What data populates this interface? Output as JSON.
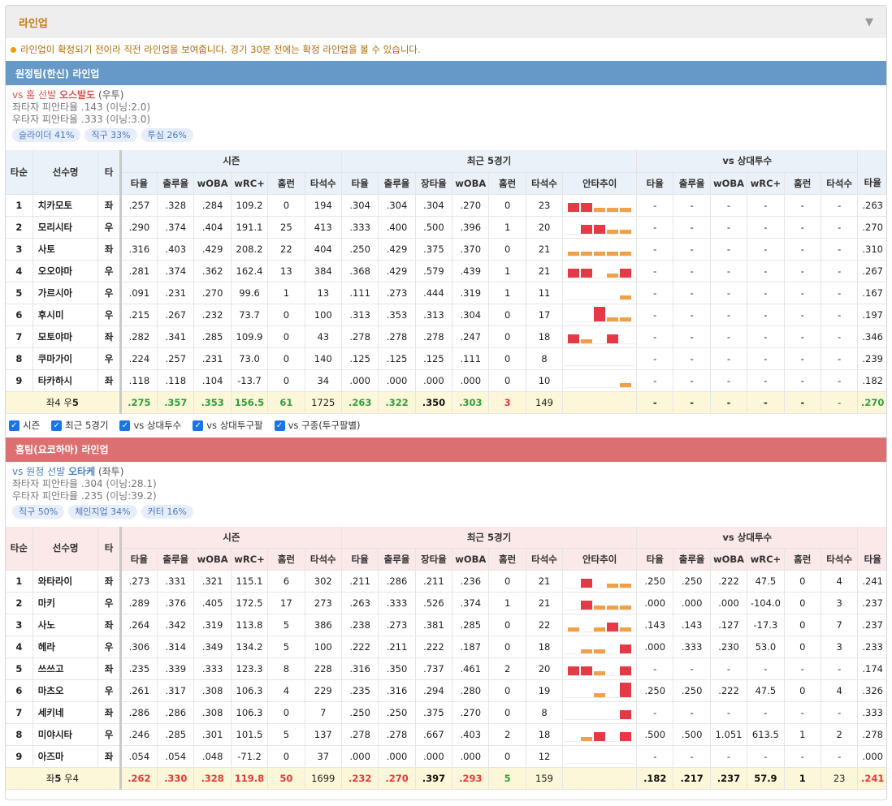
{
  "title": "라인업",
  "notice": "라인업이 확정되기 전이라 직전 라인업을 보여줍니다. 경기 30분 전에는 확정 라인업을 볼 수 있습니다.",
  "checkboxes": [
    "시즌",
    "최근 5경기",
    "vs 상대투수",
    "vs 상대투구팔",
    "vs 구종(투구팔별)"
  ],
  "headers": {
    "order": "타순",
    "name": "선수명",
    "hand": "타",
    "season": "시즌",
    "recent": "최근 5경기",
    "vs": "vs 상대투수",
    "trend": "안타추이",
    "cols_season": [
      "타율",
      "출루율",
      "wOBA",
      "wRC+",
      "홈런",
      "타석수"
    ],
    "cols_recent": [
      "타율",
      "출루율",
      "장타율",
      "wOBA",
      "홈런",
      "타석수"
    ],
    "cols_vs": [
      "타율",
      "출루율",
      "wOBA",
      "wRC+",
      "홈런",
      "타석수"
    ],
    "col_last": "타율"
  },
  "colors": {
    "hit_high": "#e53945",
    "hit_low": "#f0a048"
  },
  "away": {
    "team": "원정팀(한신) 라인업",
    "vs_label": "vs 홈 선발",
    "pitcher": "오스발도",
    "hand": "(우투)",
    "stat1": "좌타자 피안타율 .143 (이닝:2.0)",
    "stat2": "우타자 피안타율 .333 (이닝:3.0)",
    "tags": [
      "슬라이더 41%",
      "직구 33%",
      "투심 26%"
    ],
    "rows": [
      {
        "no": "1",
        "name": "치카모토",
        "hand": "좌",
        "season": [
          ".257",
          ".328",
          ".284",
          "109.2",
          "0",
          "194"
        ],
        "recent": [
          ".304",
          ".304",
          ".304",
          ".270",
          "0",
          "23"
        ],
        "trend": [
          2,
          2,
          1,
          1,
          1
        ],
        "vs": [
          "-",
          "-",
          "-",
          "-",
          "-",
          "-"
        ],
        "last": ".263"
      },
      {
        "no": "2",
        "name": "모리시타",
        "hand": "우",
        "season": [
          ".290",
          ".374",
          ".404",
          "191.1",
          "25",
          "413"
        ],
        "recent": [
          ".333",
          ".400",
          ".500",
          ".396",
          "1",
          "20"
        ],
        "trend": [
          0,
          2,
          2,
          1,
          1
        ],
        "vs": [
          "-",
          "-",
          "-",
          "-",
          "-",
          "-"
        ],
        "last": ".270"
      },
      {
        "no": "3",
        "name": "사토",
        "hand": "좌",
        "season": [
          ".316",
          ".403",
          ".429",
          "208.2",
          "22",
          "404"
        ],
        "recent": [
          ".250",
          ".429",
          ".375",
          ".370",
          "0",
          "21"
        ],
        "trend": [
          1,
          1,
          1,
          1,
          1
        ],
        "vs": [
          "-",
          "-",
          "-",
          "-",
          "-",
          "-"
        ],
        "last": ".310"
      },
      {
        "no": "4",
        "name": "오오야마",
        "hand": "우",
        "season": [
          ".281",
          ".374",
          ".362",
          "162.4",
          "13",
          "384"
        ],
        "recent": [
          ".368",
          ".429",
          ".579",
          ".439",
          "1",
          "21"
        ],
        "trend": [
          2,
          2,
          0,
          1,
          2
        ],
        "vs": [
          "-",
          "-",
          "-",
          "-",
          "-",
          "-"
        ],
        "last": ".267"
      },
      {
        "no": "5",
        "name": "가르시아",
        "hand": "우",
        "season": [
          ".091",
          ".231",
          ".270",
          "99.6",
          "1",
          "13"
        ],
        "recent": [
          ".111",
          ".273",
          ".444",
          ".319",
          "1",
          "11"
        ],
        "trend": [
          0,
          0,
          0,
          0,
          1
        ],
        "vs": [
          "-",
          "-",
          "-",
          "-",
          "-",
          "-"
        ],
        "last": ".167"
      },
      {
        "no": "6",
        "name": "후시미",
        "hand": "우",
        "season": [
          ".215",
          ".267",
          ".232",
          "73.7",
          "0",
          "100"
        ],
        "recent": [
          ".313",
          ".353",
          ".313",
          ".304",
          "0",
          "17"
        ],
        "trend": [
          0,
          0,
          3,
          1,
          1
        ],
        "vs": [
          "-",
          "-",
          "-",
          "-",
          "-",
          "-"
        ],
        "last": ".197"
      },
      {
        "no": "7",
        "name": "모토야마",
        "hand": "좌",
        "season": [
          ".282",
          ".341",
          ".285",
          "109.9",
          "0",
          "43"
        ],
        "recent": [
          ".278",
          ".278",
          ".278",
          ".247",
          "0",
          "18"
        ],
        "trend": [
          2,
          1,
          0,
          2,
          0
        ],
        "vs": [
          "-",
          "-",
          "-",
          "-",
          "-",
          "-"
        ],
        "last": ".346"
      },
      {
        "no": "8",
        "name": "쿠마가이",
        "hand": "우",
        "season": [
          ".224",
          ".257",
          ".231",
          "73.0",
          "0",
          "140"
        ],
        "recent": [
          ".125",
          ".125",
          ".125",
          ".111",
          "0",
          "8"
        ],
        "trend": [
          0,
          0,
          0,
          0,
          0
        ],
        "vs": [
          "-",
          "-",
          "-",
          "-",
          "-",
          "-"
        ],
        "last": ".239"
      },
      {
        "no": "9",
        "name": "타카하시",
        "hand": "좌",
        "season": [
          ".118",
          ".118",
          ".104",
          "-13.7",
          "0",
          "34"
        ],
        "recent": [
          ".000",
          ".000",
          ".000",
          ".000",
          "0",
          "10"
        ],
        "trend": [
          0,
          0,
          0,
          0,
          1
        ],
        "vs": [
          "-",
          "-",
          "-",
          "-",
          "-",
          "-"
        ],
        "last": ".182"
      }
    ],
    "total": {
      "label_pre": "좌4 우",
      "label_bold": "5",
      "season": [
        ".275",
        ".357",
        ".353",
        "156.5",
        "61",
        "1725"
      ],
      "recent": [
        ".263",
        ".322",
        ".350",
        ".303",
        "3",
        "149"
      ],
      "vs": [
        "-",
        "-",
        "-",
        "-",
        "-",
        "-"
      ],
      "last": ".270"
    }
  },
  "home": {
    "team": "홈팀(요코하마) 라인업",
    "vs_label": "vs 원정 선발",
    "pitcher": "오타케",
    "hand": "(좌투)",
    "stat1": "좌타자 피안타율 .304 (이닝:28.1)",
    "stat2": "우타자 피안타율 .235 (이닝:39.2)",
    "tags": [
      "직구 50%",
      "체인지업 34%",
      "커터 16%"
    ],
    "rows": [
      {
        "no": "1",
        "name": "와타라이",
        "hand": "좌",
        "season": [
          ".273",
          ".331",
          ".321",
          "115.1",
          "6",
          "302"
        ],
        "recent": [
          ".211",
          ".286",
          ".211",
          ".236",
          "0",
          "21"
        ],
        "trend": [
          0,
          2,
          0,
          1,
          1
        ],
        "vs": [
          ".250",
          ".250",
          ".222",
          "47.5",
          "0",
          "4"
        ],
        "last": ".241"
      },
      {
        "no": "2",
        "name": "마키",
        "hand": "우",
        "season": [
          ".289",
          ".376",
          ".405",
          "172.5",
          "17",
          "273"
        ],
        "recent": [
          ".263",
          ".333",
          ".526",
          ".374",
          "1",
          "21"
        ],
        "trend": [
          0,
          2,
          1,
          1,
          1
        ],
        "vs": [
          ".000",
          ".000",
          ".000",
          "-104.0",
          "0",
          "3"
        ],
        "last": ".237"
      },
      {
        "no": "3",
        "name": "사노",
        "hand": "좌",
        "season": [
          ".264",
          ".342",
          ".319",
          "113.8",
          "5",
          "386"
        ],
        "recent": [
          ".238",
          ".273",
          ".381",
          ".285",
          "0",
          "22"
        ],
        "trend": [
          1,
          0,
          1,
          2,
          1
        ],
        "vs": [
          ".143",
          ".143",
          ".127",
          "-17.3",
          "0",
          "7"
        ],
        "last": ".237"
      },
      {
        "no": "4",
        "name": "헤라",
        "hand": "우",
        "season": [
          ".306",
          ".314",
          ".349",
          "134.2",
          "5",
          "100"
        ],
        "recent": [
          ".222",
          ".211",
          ".222",
          ".187",
          "0",
          "18"
        ],
        "trend": [
          0,
          1,
          1,
          0,
          2
        ],
        "vs": [
          ".000",
          ".333",
          ".230",
          "53.0",
          "0",
          "3"
        ],
        "last": ".233"
      },
      {
        "no": "5",
        "name": "쓰쓰고",
        "hand": "좌",
        "season": [
          ".235",
          ".339",
          ".333",
          "123.3",
          "8",
          "228"
        ],
        "recent": [
          ".316",
          ".350",
          ".737",
          ".461",
          "2",
          "20"
        ],
        "trend": [
          2,
          2,
          1,
          0,
          2
        ],
        "vs": [
          "-",
          "-",
          "-",
          "-",
          "-",
          "-"
        ],
        "last": ".174"
      },
      {
        "no": "6",
        "name": "마츠오",
        "hand": "우",
        "season": [
          ".261",
          ".317",
          ".308",
          "106.3",
          "4",
          "229"
        ],
        "recent": [
          ".235",
          ".316",
          ".294",
          ".280",
          "0",
          "19"
        ],
        "trend": [
          0,
          0,
          1,
          0,
          3
        ],
        "vs": [
          ".250",
          ".250",
          ".222",
          "47.5",
          "0",
          "4"
        ],
        "last": ".326"
      },
      {
        "no": "7",
        "name": "세키네",
        "hand": "좌",
        "season": [
          ".286",
          ".286",
          ".308",
          "106.3",
          "0",
          "7"
        ],
        "recent": [
          ".250",
          ".250",
          ".375",
          ".270",
          "0",
          "8"
        ],
        "trend": [
          0,
          0,
          0,
          0,
          2
        ],
        "vs": [
          "-",
          "-",
          "-",
          "-",
          "-",
          "-"
        ],
        "last": ".333"
      },
      {
        "no": "8",
        "name": "미야시타",
        "hand": "우",
        "season": [
          ".246",
          ".285",
          ".301",
          "101.5",
          "5",
          "137"
        ],
        "recent": [
          ".278",
          ".278",
          ".667",
          ".403",
          "2",
          "18"
        ],
        "trend": [
          0,
          1,
          2,
          0,
          2
        ],
        "vs": [
          ".500",
          ".500",
          "1.051",
          "613.5",
          "1",
          "2"
        ],
        "last": ".278"
      },
      {
        "no": "9",
        "name": "아즈마",
        "hand": "좌",
        "season": [
          ".054",
          ".054",
          ".048",
          "-71.2",
          "0",
          "37"
        ],
        "recent": [
          ".000",
          ".000",
          ".000",
          ".000",
          "0",
          "12"
        ],
        "trend": [
          0,
          0,
          0,
          0,
          0
        ],
        "vs": [
          "-",
          "-",
          "-",
          "-",
          "-",
          "-"
        ],
        "last": ".000"
      }
    ],
    "total": {
      "label_pre": "좌",
      "label_bold": "5",
      "label_post": " 우4",
      "season": [
        ".262",
        ".330",
        ".328",
        "119.8",
        "50",
        "1699"
      ],
      "recent": [
        ".232",
        ".270",
        ".397",
        ".293",
        "5",
        "159"
      ],
      "vs": [
        ".182",
        ".217",
        ".237",
        "57.9",
        "1",
        "23"
      ],
      "last": ".241"
    }
  }
}
